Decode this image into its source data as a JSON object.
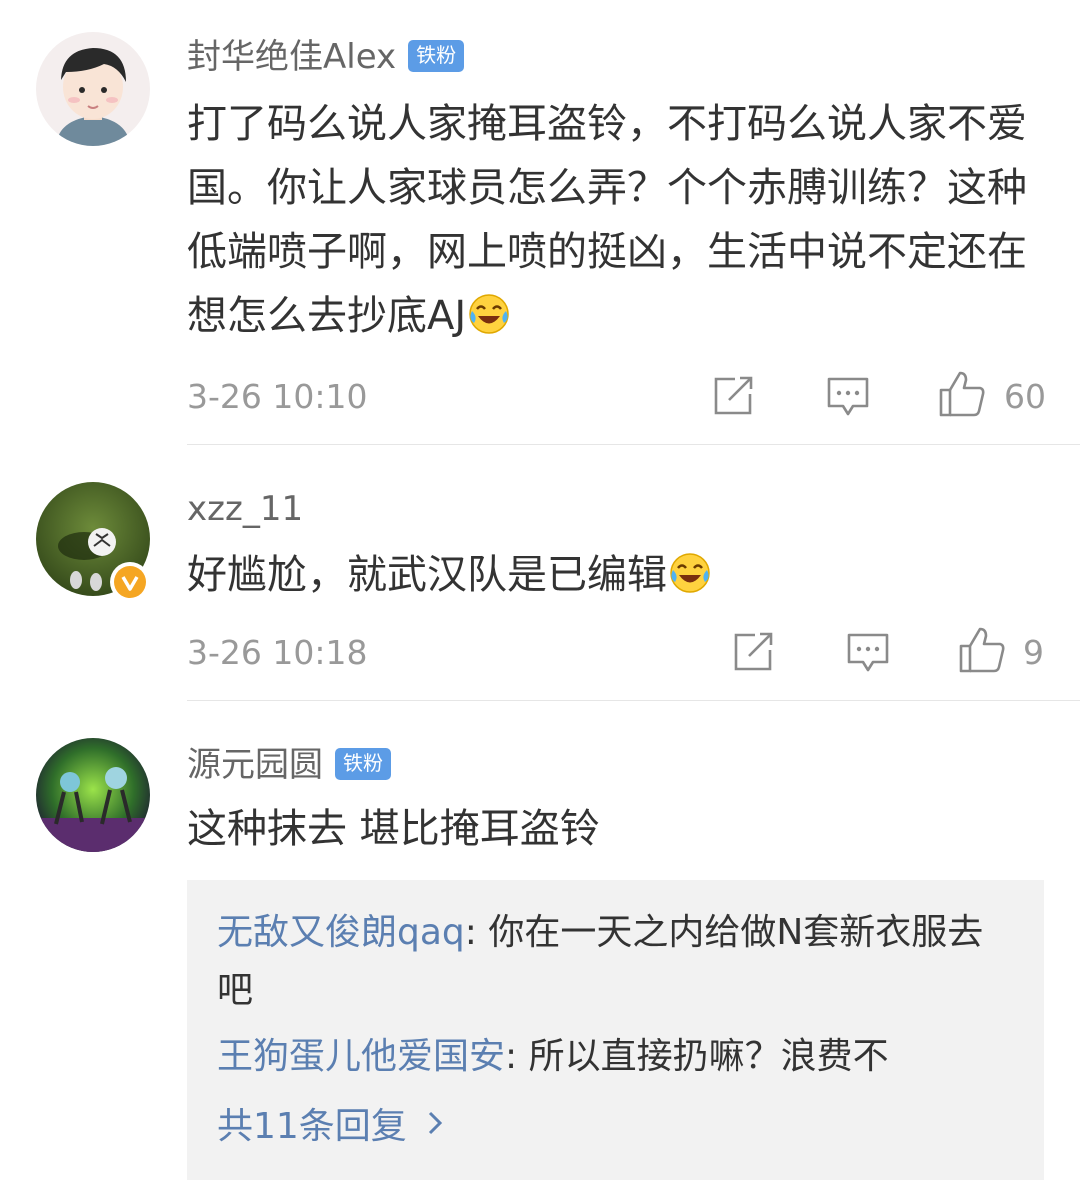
{
  "comments": [
    {
      "username": "封华绝佳Alex",
      "badge": "铁粉",
      "text": "打了码么说人家掩耳盗铃，不打码么说人家不爱国。你让人家球员怎么弄？个个赤膊训练？这种低端喷子啊，网上喷的挺凶，生活中说不定还在想怎么去抄底AJ",
      "emoji": "laugh-cry-emoji",
      "time": "3-26 10:10",
      "likes": "60"
    },
    {
      "username": "xzz_11",
      "verified": "v-badge-icon",
      "text": "好尴尬，就武汉队是已编辑",
      "emoji": "laugh-cry-emoji",
      "time": "3-26 10:18",
      "likes": "9"
    },
    {
      "username": "源元园圆",
      "badge": "铁粉",
      "text": "这种抹去 堪比掩耳盗铃",
      "replies": [
        {
          "name": "无敌又俊朗qaq",
          "sep": ": ",
          "text": "你在一天之内给做N套新衣服去吧"
        },
        {
          "name": "王狗蛋儿他爱国安",
          "sep": ": ",
          "text": "所以直接扔嘛？浪费不"
        }
      ],
      "more_replies": "共11条回复"
    }
  ],
  "icons": {
    "share": "share-icon",
    "comment": "comment-icon",
    "like": "thumbs-up-icon",
    "more": "chevron-right-icon"
  },
  "colors": {
    "username": "#666666",
    "text": "#333333",
    "meta": "#999999",
    "badge_bg": "#5c9ce6",
    "link": "#5b7fb1",
    "reply_bg": "#f2f2f2",
    "verified": "#f5a623"
  }
}
